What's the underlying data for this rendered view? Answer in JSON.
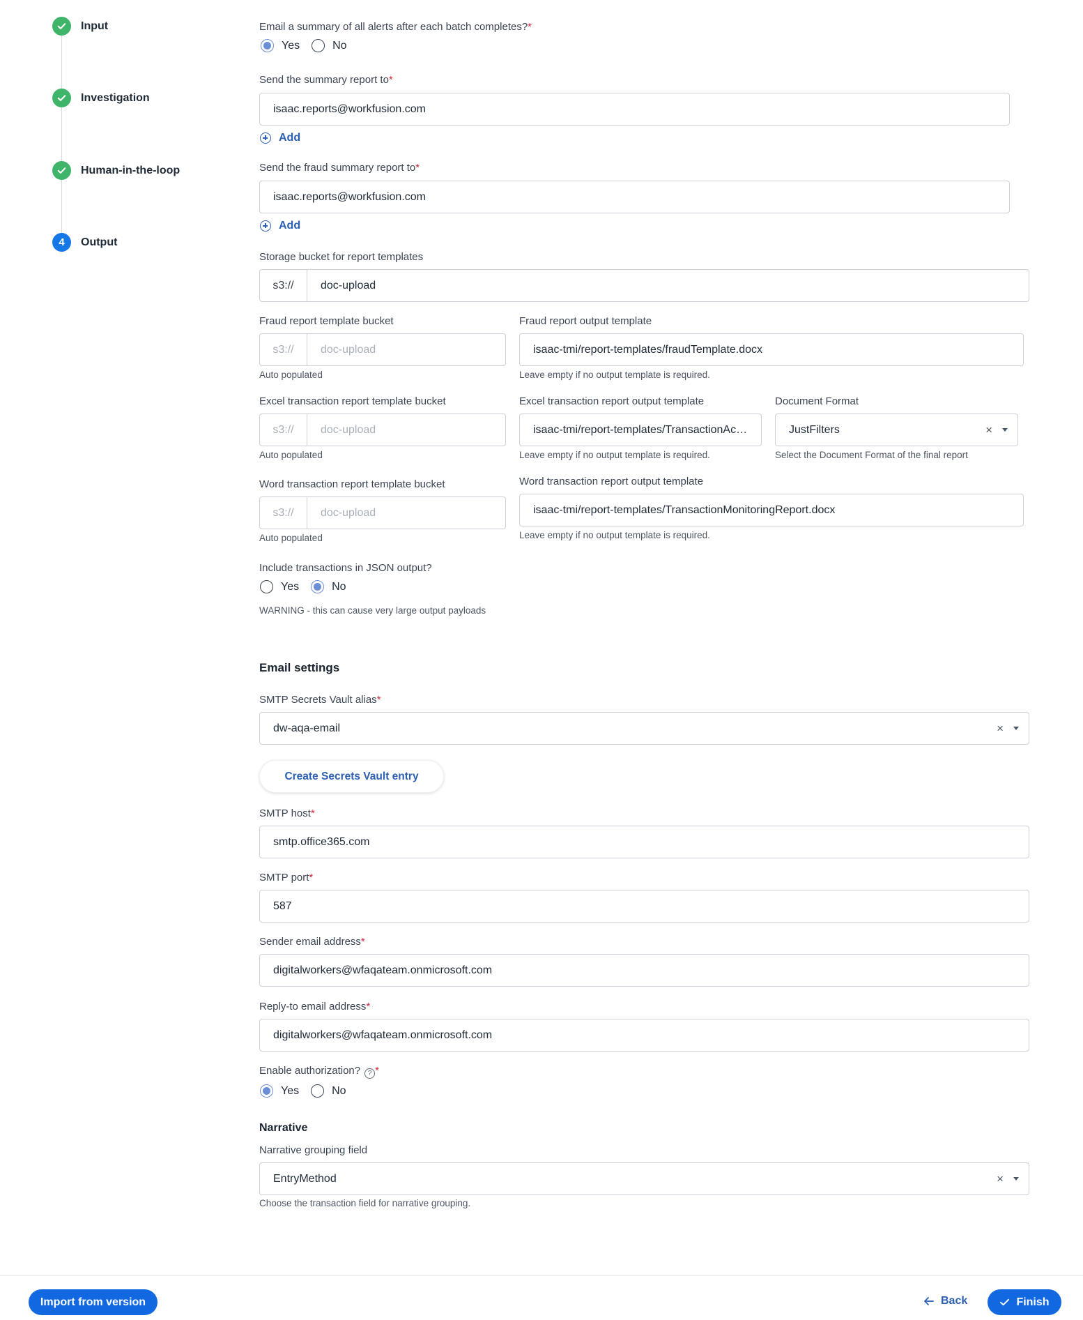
{
  "stepper": {
    "steps": [
      {
        "label": "Input",
        "status": "done"
      },
      {
        "label": "Investigation",
        "status": "done"
      },
      {
        "label": "Human-in-the-loop",
        "status": "done"
      },
      {
        "label": "Output",
        "status": "current",
        "number": "4"
      }
    ]
  },
  "summary_email": {
    "question": "Email a summary of all alerts after each batch completes?",
    "required_mark": "*",
    "options": [
      "Yes",
      "No"
    ],
    "selected": "Yes"
  },
  "summary_report": {
    "label": "Send the summary report to",
    "required_mark": "*",
    "value": "isaac.reports@workfusion.com",
    "add_label": "Add"
  },
  "fraud_summary_report": {
    "label": "Send the fraud summary report to",
    "required_mark": "*",
    "value": "isaac.reports@workfusion.com",
    "add_label": "Add"
  },
  "storage_bucket": {
    "label": "Storage bucket for report templates",
    "prefix": "s3://",
    "value": "doc-upload"
  },
  "fraud_template_bucket": {
    "label": "Fraud report template bucket",
    "prefix": "s3://",
    "value": "doc-upload",
    "hint": "Auto populated"
  },
  "fraud_output_template": {
    "label": "Fraud report output template",
    "value": "isaac-tmi/report-templates/fraudTemplate.docx",
    "hint": "Leave empty if no output template is required."
  },
  "excel_template_bucket": {
    "label": "Excel transaction report template bucket",
    "prefix": "s3://",
    "value": "doc-upload",
    "hint": "Auto populated"
  },
  "excel_output_template": {
    "label": "Excel transaction report output template",
    "value": "isaac-tmi/report-templates/TransactionActi...",
    "hint": "Leave empty if no output template is required."
  },
  "document_format": {
    "label": "Document Format",
    "value": "JustFilters",
    "hint": "Select the Document Format of the final report",
    "clear": "×"
  },
  "word_template_bucket": {
    "label": "Word transaction report template bucket",
    "prefix": "s3://",
    "value": "doc-upload",
    "hint": "Auto populated"
  },
  "word_output_template": {
    "label": "Word transaction report output template",
    "value": "isaac-tmi/report-templates/TransactionMonitoringReport.docx",
    "hint": "Leave empty if no output template is required."
  },
  "include_transactions": {
    "question": "Include transactions in JSON output?",
    "options": [
      "Yes",
      "No"
    ],
    "selected": "No",
    "warning": "WARNING - this can cause very large output payloads"
  },
  "email_settings": {
    "title": "Email settings",
    "vault_alias": {
      "label": "SMTP Secrets Vault alias",
      "required_mark": "*",
      "value": "dw-aqa-email",
      "clear": "×"
    },
    "create_vault_entry": "Create Secrets Vault entry",
    "smtp_host": {
      "label": "SMTP host",
      "required_mark": "*",
      "value": "smtp.office365.com"
    },
    "smtp_port": {
      "label": "SMTP port",
      "required_mark": "*",
      "value": "587"
    },
    "sender_email": {
      "label": "Sender email address",
      "required_mark": "*",
      "value": "digitalworkers@wfaqateam.onmicrosoft.com"
    },
    "reply_to_email": {
      "label": "Reply-to email address",
      "required_mark": "*",
      "value": "digitalworkers@wfaqateam.onmicrosoft.com"
    },
    "enable_auth": {
      "label": "Enable authorization?",
      "required_mark": "*",
      "help_icon": "?",
      "options": [
        "Yes",
        "No"
      ],
      "selected": "Yes"
    }
  },
  "narrative": {
    "title": "Narrative",
    "grouping_field": {
      "label": "Narrative grouping field",
      "value": "EntryMethod",
      "hint": "Choose the transaction field for narrative grouping.",
      "clear": "×"
    }
  },
  "footer": {
    "import_label": "Import from version",
    "back_label": "Back",
    "finish_label": "Finish"
  },
  "colors": {
    "accent": "#1268e0",
    "link": "#2b5fb3",
    "success": "#3fb56a",
    "required": "#d7263d",
    "radio_selected": "#6b8fd6"
  },
  "icons": [
    "check-icon",
    "plus-circle-icon",
    "close-icon",
    "chevron-down-icon",
    "help-icon",
    "arrow-left-icon"
  ]
}
